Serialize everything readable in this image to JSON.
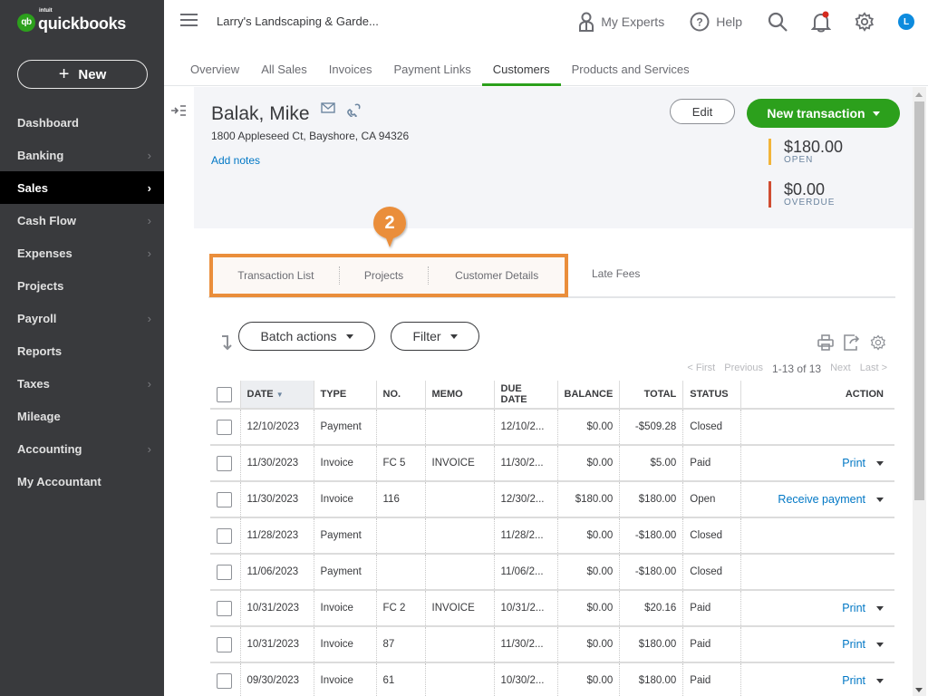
{
  "app": {
    "logo_intuit": "intuit",
    "logo_name": "quickbooks",
    "logo_mark": "qb",
    "company_name": "Larry's Landscaping & Garde..."
  },
  "sidebar": {
    "new_label": "New",
    "items": [
      {
        "label": "Dashboard",
        "chevron": false,
        "active": false
      },
      {
        "label": "Banking",
        "chevron": true,
        "active": false
      },
      {
        "label": "Sales",
        "chevron": true,
        "active": true
      },
      {
        "label": "Cash Flow",
        "chevron": true,
        "active": false
      },
      {
        "label": "Expenses",
        "chevron": true,
        "active": false
      },
      {
        "label": "Projects",
        "chevron": false,
        "active": false
      },
      {
        "label": "Payroll",
        "chevron": true,
        "active": false
      },
      {
        "label": "Reports",
        "chevron": false,
        "active": false
      },
      {
        "label": "Taxes",
        "chevron": true,
        "active": false
      },
      {
        "label": "Mileage",
        "chevron": false,
        "active": false
      },
      {
        "label": "Accounting",
        "chevron": true,
        "active": false
      },
      {
        "label": "My Accountant",
        "chevron": false,
        "active": false
      }
    ]
  },
  "topbar": {
    "my_experts": "My Experts",
    "help": "Help",
    "avatar_initial": "L",
    "icons": [
      "my-experts-icon",
      "help-icon",
      "search-icon",
      "notification-bell-icon",
      "gear-icon"
    ]
  },
  "subtabs": [
    {
      "label": "Overview",
      "active": false
    },
    {
      "label": "All Sales",
      "active": false
    },
    {
      "label": "Invoices",
      "active": false
    },
    {
      "label": "Payment Links",
      "active": false
    },
    {
      "label": "Customers",
      "active": true
    },
    {
      "label": "Products and Services",
      "active": false
    }
  ],
  "customer": {
    "name": "Balak, Mike",
    "address": "1800 Appleseed Ct, Bayshore, CA 94326",
    "add_notes": "Add notes",
    "edit_label": "Edit",
    "new_transaction_label": "New transaction",
    "open_amount": "$180.00",
    "open_label": "OPEN",
    "overdue_amount": "$0.00",
    "overdue_label": "OVERDUE"
  },
  "colors": {
    "brand_green": "#2ca01c",
    "link_blue": "#0077c5",
    "open_bar": "#f2b43a",
    "overdue_bar": "#d04d32",
    "callout_orange": "#ea8e3b"
  },
  "callout": {
    "number": "2"
  },
  "detail_tabs": [
    {
      "label": "Transaction List"
    },
    {
      "label": "Projects"
    },
    {
      "label": "Customer Details"
    },
    {
      "label": "Late Fees"
    }
  ],
  "toolbar": {
    "batch_actions": "Batch actions",
    "filter": "Filter"
  },
  "pager": {
    "first": "< First",
    "previous": "Previous",
    "count": "1-13 of 13",
    "next": "Next",
    "last": "Last >"
  },
  "table": {
    "headers": [
      "DATE",
      "TYPE",
      "NO.",
      "MEMO",
      "DUE DATE",
      "BALANCE",
      "TOTAL",
      "STATUS",
      "ACTION"
    ],
    "rows": [
      {
        "date": "12/10/2023",
        "type": "Payment",
        "no": "",
        "memo": "",
        "due": "12/10/2...",
        "balance": "$0.00",
        "total": "-$509.28",
        "status": "Closed",
        "action": ""
      },
      {
        "date": "11/30/2023",
        "type": "Invoice",
        "no": "FC 5",
        "memo": "INVOICE",
        "due": "11/30/2...",
        "balance": "$0.00",
        "total": "$5.00",
        "status": "Paid",
        "action": "Print"
      },
      {
        "date": "11/30/2023",
        "type": "Invoice",
        "no": "116",
        "memo": "",
        "due": "12/30/2...",
        "balance": "$180.00",
        "total": "$180.00",
        "status": "Open",
        "action": "Receive payment"
      },
      {
        "date": "11/28/2023",
        "type": "Payment",
        "no": "",
        "memo": "",
        "due": "11/28/2...",
        "balance": "$0.00",
        "total": "-$180.00",
        "status": "Closed",
        "action": ""
      },
      {
        "date": "11/06/2023",
        "type": "Payment",
        "no": "",
        "memo": "",
        "due": "11/06/2...",
        "balance": "$0.00",
        "total": "-$180.00",
        "status": "Closed",
        "action": ""
      },
      {
        "date": "10/31/2023",
        "type": "Invoice",
        "no": "FC 2",
        "memo": "INVOICE",
        "due": "10/31/2...",
        "balance": "$0.00",
        "total": "$20.16",
        "status": "Paid",
        "action": "Print"
      },
      {
        "date": "10/31/2023",
        "type": "Invoice",
        "no": "87",
        "memo": "",
        "due": "11/30/2...",
        "balance": "$0.00",
        "total": "$180.00",
        "status": "Paid",
        "action": "Print"
      },
      {
        "date": "09/30/2023",
        "type": "Invoice",
        "no": "61",
        "memo": "",
        "due": "10/30/2...",
        "balance": "$0.00",
        "total": "$180.00",
        "status": "Paid",
        "action": "Print"
      }
    ]
  }
}
